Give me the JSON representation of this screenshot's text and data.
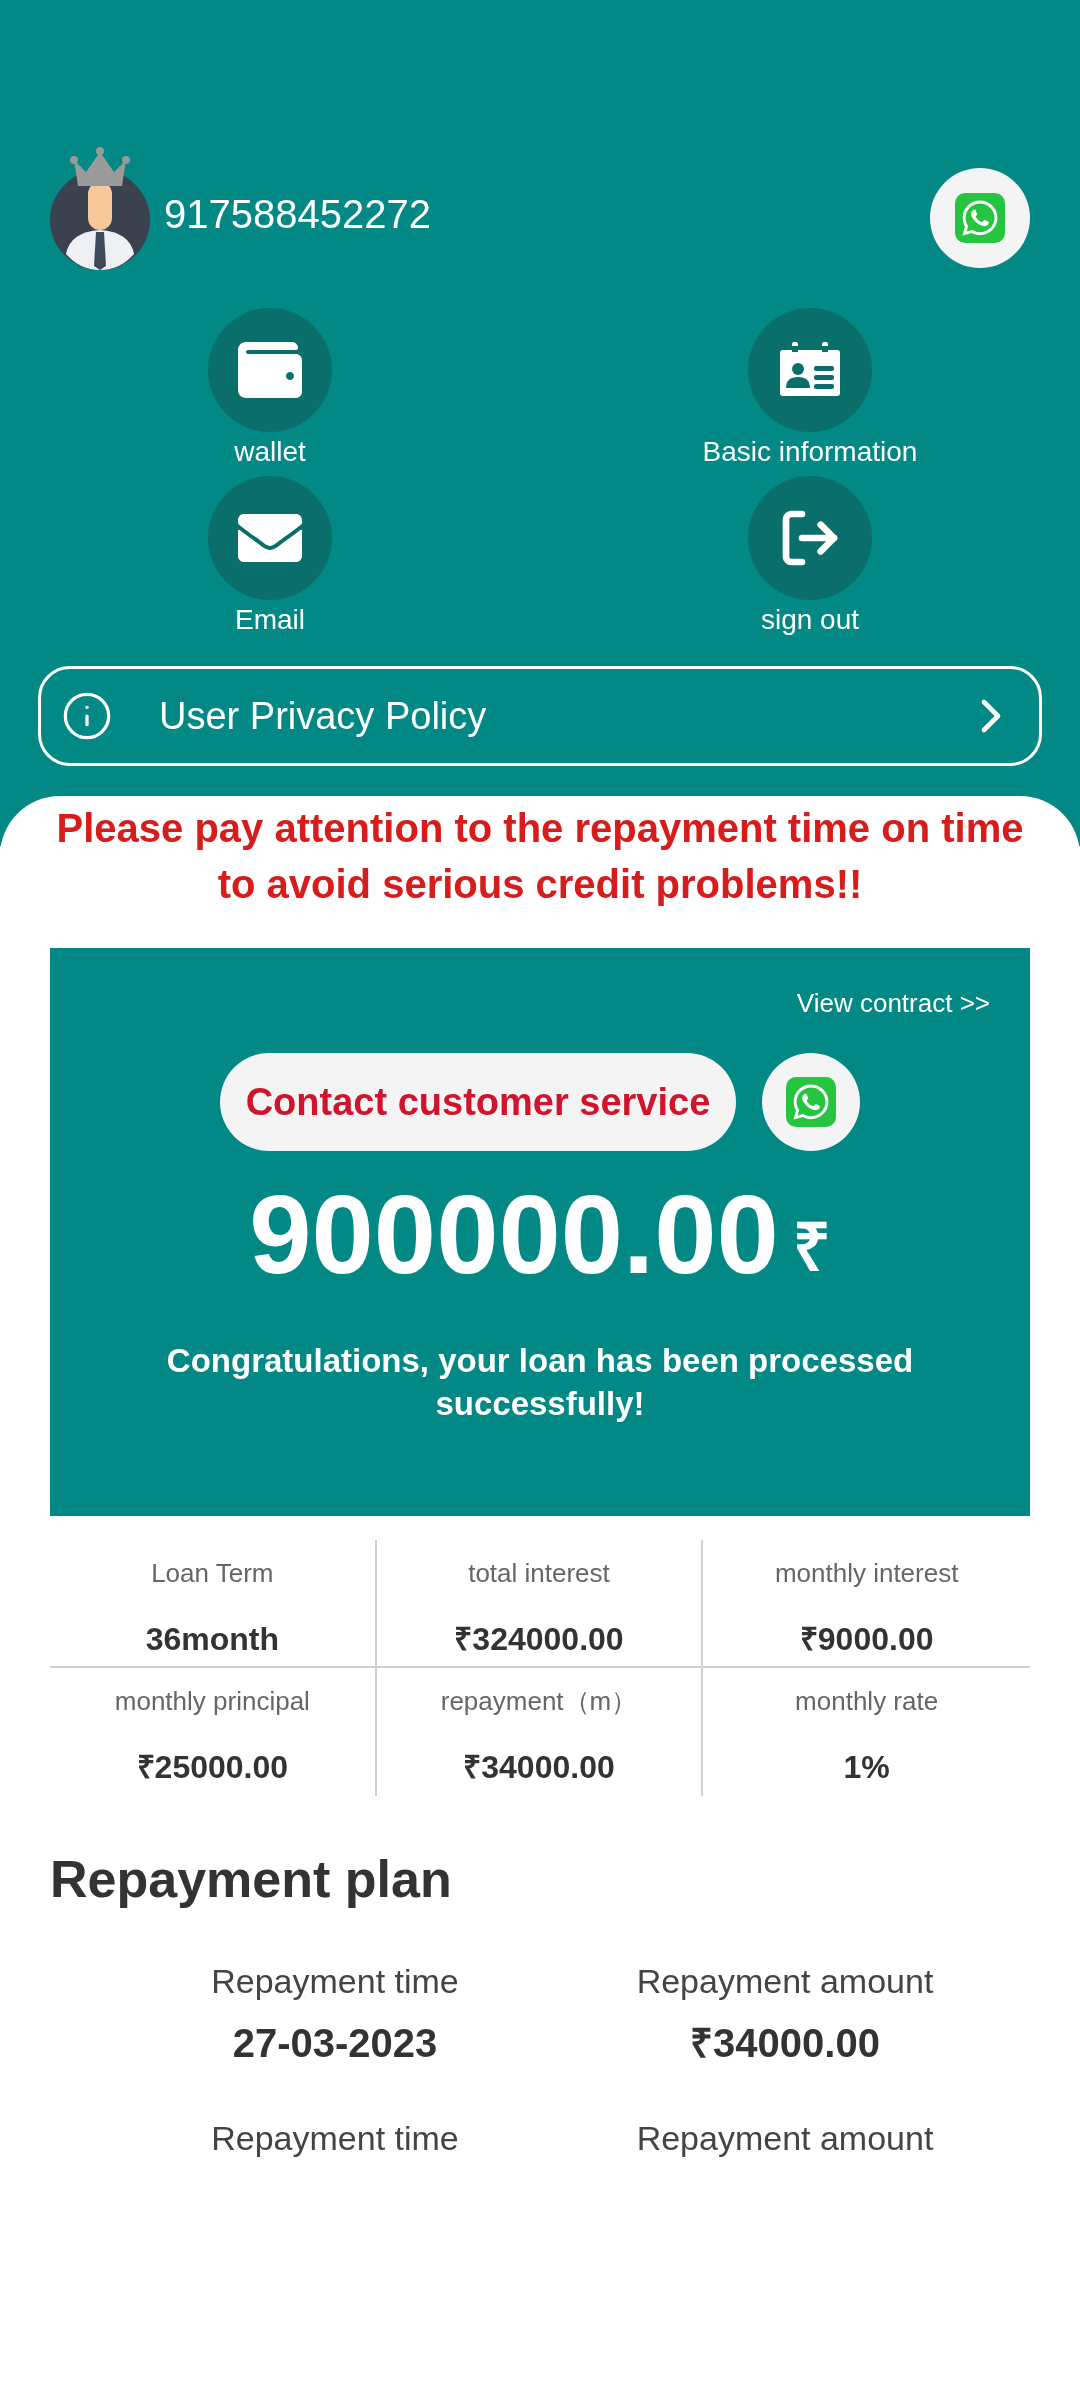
{
  "header": {
    "phone": "917588452272"
  },
  "menu": [
    {
      "kind": "wallet",
      "label": "wallet"
    },
    {
      "kind": "id-card",
      "label": "Basic information"
    },
    {
      "kind": "mail",
      "label": "Email"
    },
    {
      "kind": "exit",
      "label": "sign out"
    }
  ],
  "privacy_link": {
    "label": "User Privacy Policy"
  },
  "warning": "Please pay attention to the repayment time on time to avoid serious credit problems!!",
  "loan": {
    "view_contract": "View contract >>",
    "contact_button": "Contact customer service",
    "amount": "900000.00",
    "currency": "₹",
    "message": "Congratulations, your loan has been processed successfully!"
  },
  "stats": [
    {
      "label": "Loan Term",
      "value": "36month"
    },
    {
      "label": "total interest",
      "value": "₹324000.00"
    },
    {
      "label": "monthly interest",
      "value": "₹9000.00"
    },
    {
      "label": "monthly principal",
      "value": "₹25000.00"
    },
    {
      "label": "repayment（m）",
      "value": "₹34000.00"
    },
    {
      "label": "monthly rate",
      "value": "1%"
    }
  ],
  "repayment_plan": {
    "title": "Repayment plan",
    "rows": [
      {
        "time_label": "Repayment time",
        "time": "27-03-2023",
        "amount_label": "Repayment amount",
        "amount": "₹34000.00"
      },
      {
        "time_label": "Repayment time",
        "amount_label": "Repayment amount"
      }
    ]
  }
}
